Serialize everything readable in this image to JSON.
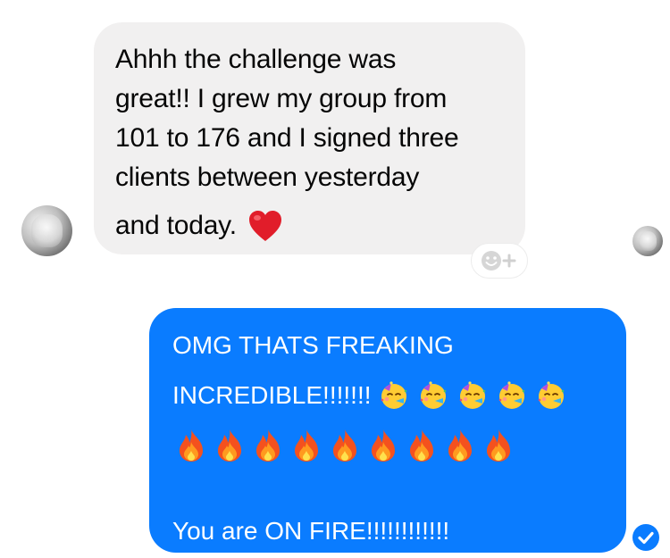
{
  "incoming": {
    "lines": [
      "Ahhh the challenge was",
      "great!! I grew my group from",
      "101 to 176 and I signed three",
      "clients between yesterday",
      "and today."
    ],
    "reaction_icon": "red-heart-emoji"
  },
  "outgoing": {
    "line1": "OMG THATS FREAKING",
    "line2": "INCREDIBLE!!!!!!!",
    "party_emoji_count": 5,
    "fire_emoji_count": 9,
    "line4": "You are ON FIRE!!!!!!!!!!!!"
  },
  "icons": {
    "add_reaction": "smiley-plus-icon",
    "read_receipt": "blue-check-circle-icon"
  },
  "colors": {
    "incoming_bubble": "#f1f0f0",
    "outgoing_bubble": "#0a7cff",
    "text_dark": "#050505",
    "text_light": "#ffffff"
  }
}
